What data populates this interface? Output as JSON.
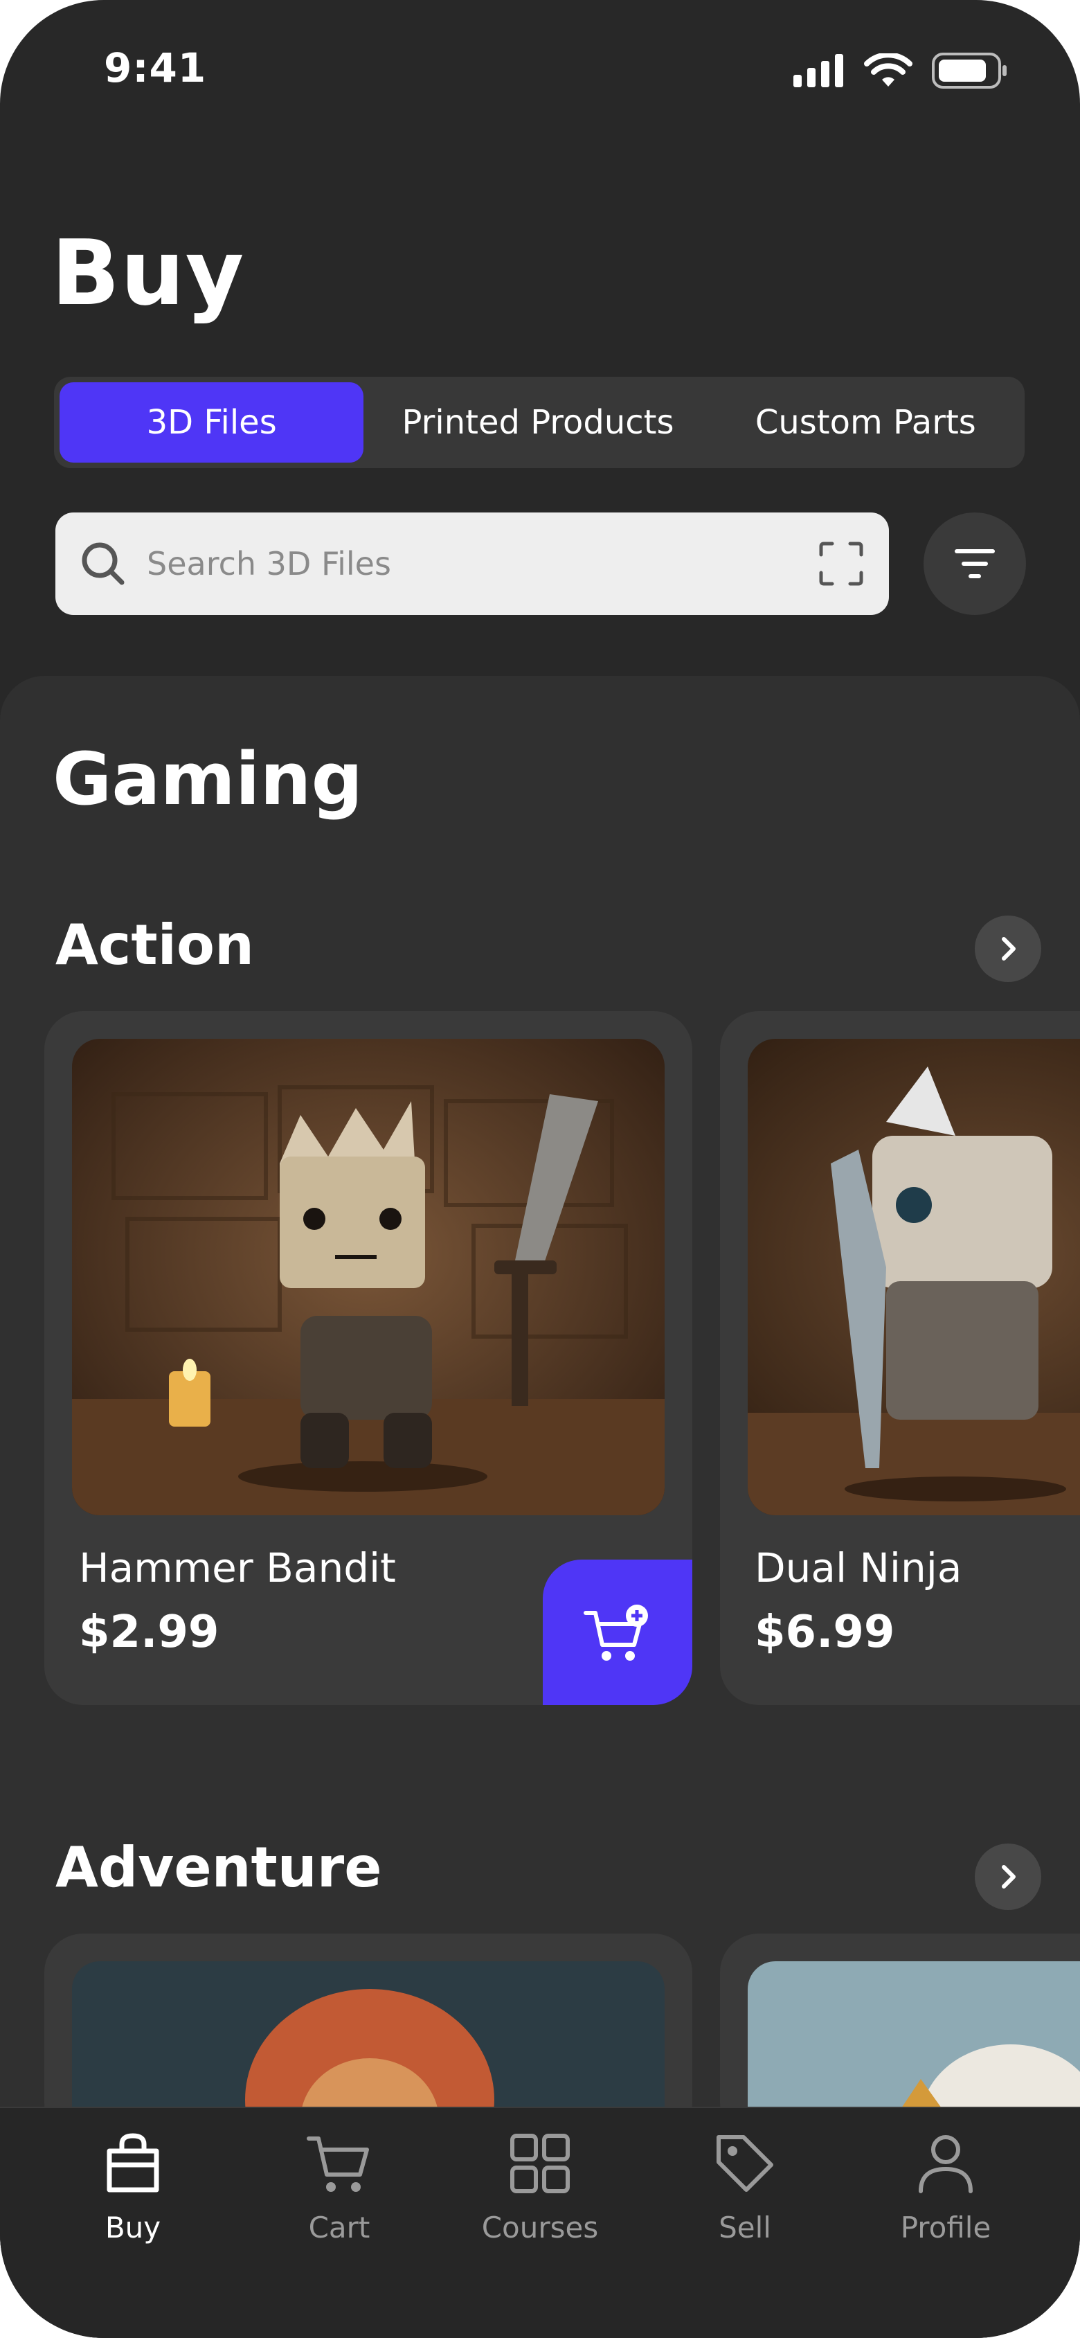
{
  "status_bar": {
    "time": "9:41"
  },
  "page_title": "Buy",
  "tabs": [
    {
      "label": "3D Files",
      "active": true
    },
    {
      "label": "Printed Products",
      "active": false
    },
    {
      "label": "Custom Parts",
      "active": false
    }
  ],
  "search": {
    "placeholder": "Search 3D Files"
  },
  "section_title": "Gaming",
  "rows": [
    {
      "title": "Action",
      "items": [
        {
          "name": "Hammer Bandit",
          "price": "$2.99"
        },
        {
          "name": "Dual Ninja",
          "price": "$6.99"
        }
      ]
    },
    {
      "title": "Adventure",
      "items": []
    }
  ],
  "bottom_nav": [
    {
      "label": "Buy",
      "icon": "shopping-bag-icon",
      "active": true
    },
    {
      "label": "Cart",
      "icon": "cart-icon",
      "active": false
    },
    {
      "label": "Courses",
      "icon": "grid-icon",
      "active": false
    },
    {
      "label": "Sell",
      "icon": "tag-icon",
      "active": false
    },
    {
      "label": "Profile",
      "icon": "user-icon",
      "active": false
    }
  ],
  "colors": {
    "accent": "#4f36f6",
    "background": "#282828",
    "panel": "#303030",
    "card": "#3a3a3a"
  }
}
